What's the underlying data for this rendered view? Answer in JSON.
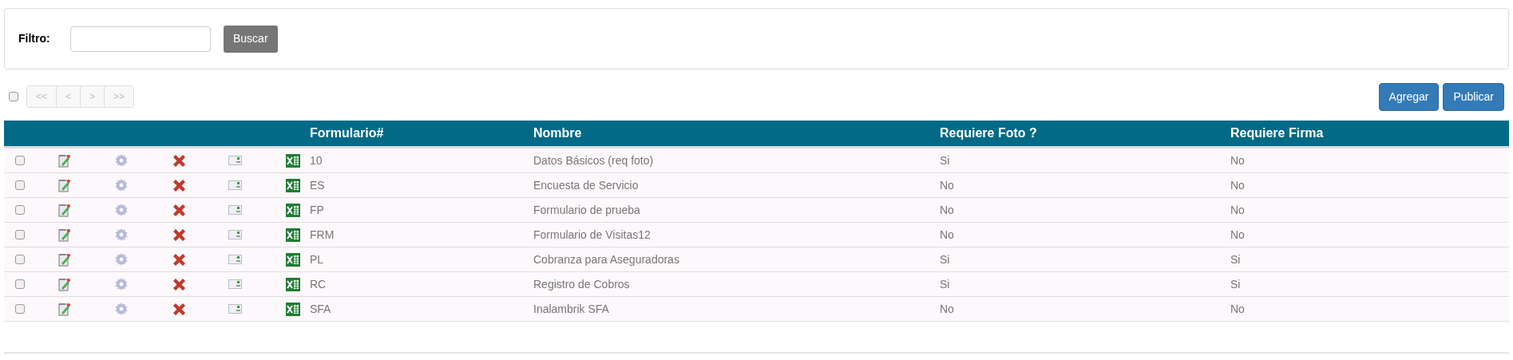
{
  "filter": {
    "label": "Filtro:",
    "button": "Buscar"
  },
  "toolbar": {
    "select_all_checked": false,
    "pager": [
      {
        "label": "<<",
        "disabled": true
      },
      {
        "label": "<",
        "disabled": true
      },
      {
        "label": ">",
        "disabled": true
      },
      {
        "label": ">>",
        "disabled": true
      }
    ],
    "buttons": [
      "Agregar",
      "Publicar"
    ]
  },
  "table": {
    "columns": [
      "Formulario#",
      "Nombre",
      "Requiere Foto ?",
      "Requiere Firma"
    ],
    "rows": [
      {
        "checked": false,
        "formulario": "10",
        "nombre": "Datos Básicos (req foto)",
        "requiere_foto": "Si",
        "requiere_firma": "No"
      },
      {
        "checked": false,
        "formulario": "ES",
        "nombre": "Encuesta de Servicio",
        "requiere_foto": "No",
        "requiere_firma": "No"
      },
      {
        "checked": false,
        "formulario": "FP",
        "nombre": "Formulario de prueba",
        "requiere_foto": "No",
        "requiere_firma": "No"
      },
      {
        "checked": false,
        "formulario": "FRM",
        "nombre": "Formulario de Visitas12",
        "requiere_foto": "No",
        "requiere_firma": "No"
      },
      {
        "checked": false,
        "formulario": "PL",
        "nombre": "Cobranza para Aseguradoras",
        "requiere_foto": "Si",
        "requiere_firma": "Si"
      },
      {
        "checked": false,
        "formulario": "RC",
        "nombre": "Registro de Cobros",
        "requiere_foto": "Si",
        "requiere_firma": "Si"
      },
      {
        "checked": false,
        "formulario": "SFA",
        "nombre": "Inalambrik SFA",
        "requiere_foto": "No",
        "requiere_firma": "No"
      }
    ]
  }
}
